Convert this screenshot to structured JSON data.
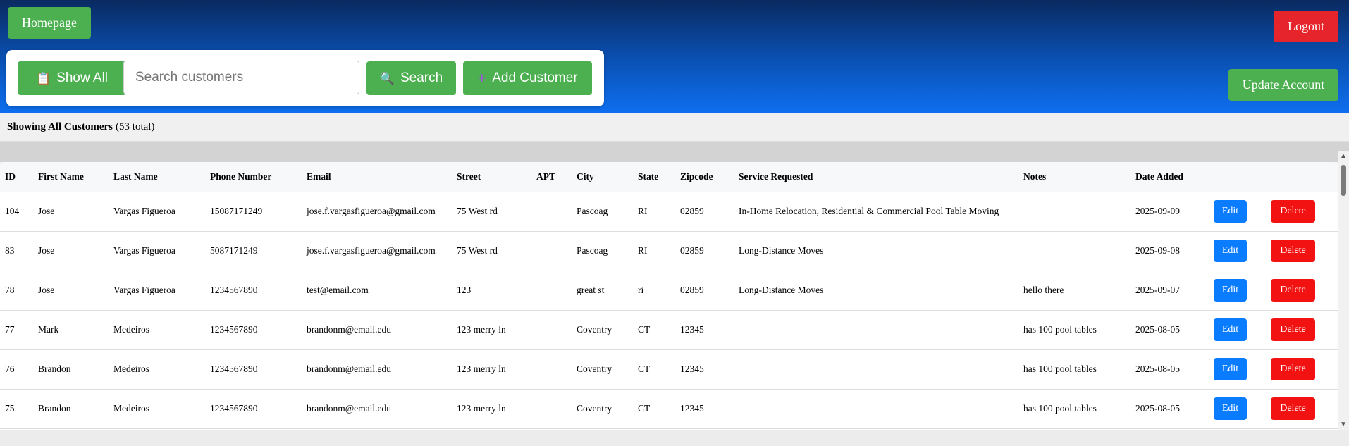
{
  "header": {
    "homepage_label": "Homepage",
    "logout_label": "Logout",
    "update_account_label": "Update Account"
  },
  "toolbar": {
    "show_all_label": "Show All",
    "search_placeholder": "Search customers",
    "search_value": "",
    "search_label": "Search",
    "add_customer_label": "Add Customer"
  },
  "summary": {
    "title": "Showing All Customers",
    "count": "(53 total)"
  },
  "table": {
    "columns": [
      "ID",
      "First Name",
      "Last Name",
      "Phone Number",
      "Email",
      "Street",
      "APT",
      "City",
      "State",
      "Zipcode",
      "Service Requested",
      "Notes",
      "Date Added",
      "",
      ""
    ],
    "edit_label": "Edit",
    "delete_label": "Delete",
    "rows": [
      [
        "104",
        "Jose",
        "Vargas Figueroa",
        "15087171249",
        "jose.f.vargasfigueroa@gmail.com",
        "75 West rd",
        "",
        "Pascoag",
        "RI",
        "02859",
        "In-Home Relocation, Residential & Commercial Pool Table Moving",
        "",
        "2025-09-09"
      ],
      [
        "83",
        "Jose",
        "Vargas Figueroa",
        "5087171249",
        "jose.f.vargasfigueroa@gmail.com",
        "75 West rd",
        "",
        "Pascoag",
        "RI",
        "02859",
        "Long-Distance Moves",
        "",
        "2025-09-08"
      ],
      [
        "78",
        "Jose",
        "Vargas Figueroa",
        "1234567890",
        "test@email.com",
        "123",
        "",
        "great st",
        "ri",
        "02859",
        "Long-Distance Moves",
        "hello there",
        "2025-09-07"
      ],
      [
        "77",
        "Mark",
        "Medeiros",
        "1234567890",
        "brandonm@email.edu",
        "123 merry ln",
        "",
        "Coventry",
        "CT",
        "12345",
        "",
        "has 100 pool tables",
        "2025-08-05"
      ],
      [
        "76",
        "Brandon",
        "Medeiros",
        "1234567890",
        "brandonm@email.edu",
        "123 merry ln",
        "",
        "Coventry",
        "CT",
        "12345",
        "",
        "has 100 pool tables",
        "2025-08-05"
      ],
      [
        "75",
        "Brandon",
        "Medeiros",
        "1234567890",
        "brandonm@email.edu",
        "123 merry ln",
        "",
        "Coventry",
        "CT",
        "12345",
        "",
        "has 100 pool tables",
        "2025-08-05"
      ]
    ]
  },
  "icons": {
    "show_all": "clipboard-icon",
    "search": "magnifier-icon",
    "add": "plus-icon"
  }
}
